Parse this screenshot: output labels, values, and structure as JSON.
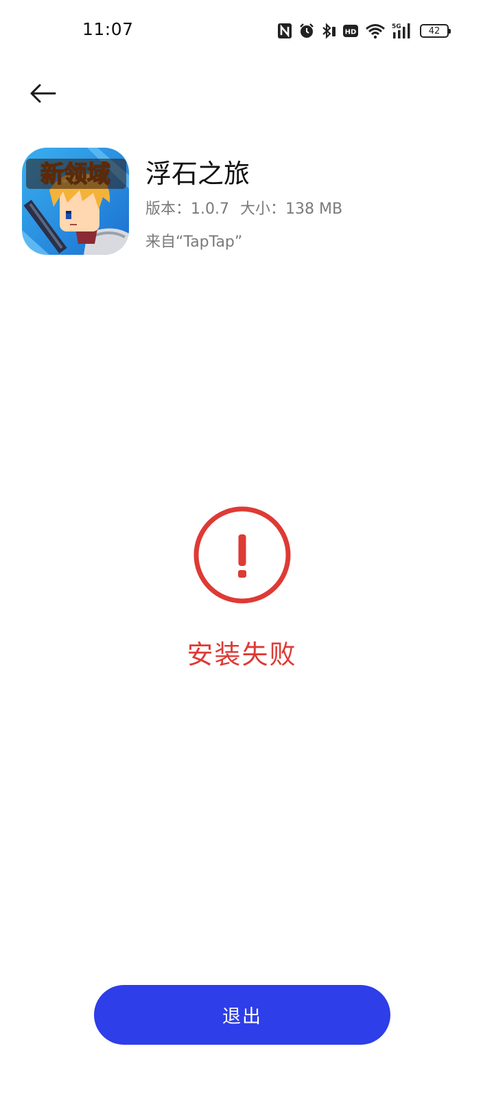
{
  "status_bar": {
    "time": "11:07",
    "icons": [
      "nfc-icon",
      "alarm-icon",
      "bluetooth-icon",
      "hd-icon",
      "wifi-icon",
      "5g-signal-icon"
    ],
    "network_label": "5G",
    "hd_label": "HD",
    "battery_level": "42"
  },
  "header": {
    "back_icon": "arrow-left-icon"
  },
  "app": {
    "name": "浮石之旅",
    "version": "版本：1.0.7",
    "size": "大小：138 MB",
    "source": "来自“TapTap”",
    "icon_text": "新领域"
  },
  "result": {
    "icon": "exclamation-circle-icon",
    "message": "安装失败"
  },
  "actions": {
    "exit_label": "退出"
  },
  "colors": {
    "error": "#de3a35",
    "primary_button": "#2e3ee8",
    "meta_text": "#7a7a7a"
  }
}
